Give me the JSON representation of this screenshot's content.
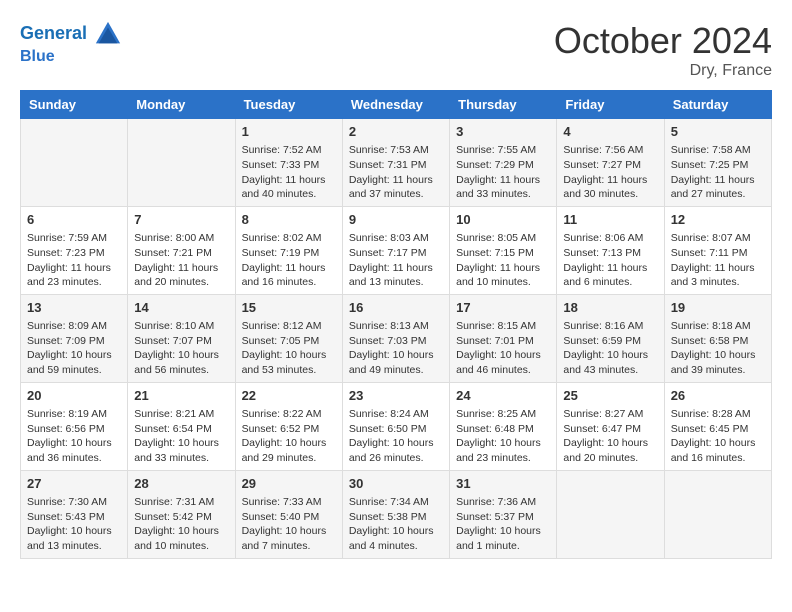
{
  "header": {
    "logo_line1": "General",
    "logo_line2": "Blue",
    "month": "October 2024",
    "location": "Dry, France"
  },
  "weekdays": [
    "Sunday",
    "Monday",
    "Tuesday",
    "Wednesday",
    "Thursday",
    "Friday",
    "Saturday"
  ],
  "weeks": [
    [
      {
        "day": "",
        "content": ""
      },
      {
        "day": "",
        "content": ""
      },
      {
        "day": "1",
        "content": "Sunrise: 7:52 AM\nSunset: 7:33 PM\nDaylight: 11 hours and 40 minutes."
      },
      {
        "day": "2",
        "content": "Sunrise: 7:53 AM\nSunset: 7:31 PM\nDaylight: 11 hours and 37 minutes."
      },
      {
        "day": "3",
        "content": "Sunrise: 7:55 AM\nSunset: 7:29 PM\nDaylight: 11 hours and 33 minutes."
      },
      {
        "day": "4",
        "content": "Sunrise: 7:56 AM\nSunset: 7:27 PM\nDaylight: 11 hours and 30 minutes."
      },
      {
        "day": "5",
        "content": "Sunrise: 7:58 AM\nSunset: 7:25 PM\nDaylight: 11 hours and 27 minutes."
      }
    ],
    [
      {
        "day": "6",
        "content": "Sunrise: 7:59 AM\nSunset: 7:23 PM\nDaylight: 11 hours and 23 minutes."
      },
      {
        "day": "7",
        "content": "Sunrise: 8:00 AM\nSunset: 7:21 PM\nDaylight: 11 hours and 20 minutes."
      },
      {
        "day": "8",
        "content": "Sunrise: 8:02 AM\nSunset: 7:19 PM\nDaylight: 11 hours and 16 minutes."
      },
      {
        "day": "9",
        "content": "Sunrise: 8:03 AM\nSunset: 7:17 PM\nDaylight: 11 hours and 13 minutes."
      },
      {
        "day": "10",
        "content": "Sunrise: 8:05 AM\nSunset: 7:15 PM\nDaylight: 11 hours and 10 minutes."
      },
      {
        "day": "11",
        "content": "Sunrise: 8:06 AM\nSunset: 7:13 PM\nDaylight: 11 hours and 6 minutes."
      },
      {
        "day": "12",
        "content": "Sunrise: 8:07 AM\nSunset: 7:11 PM\nDaylight: 11 hours and 3 minutes."
      }
    ],
    [
      {
        "day": "13",
        "content": "Sunrise: 8:09 AM\nSunset: 7:09 PM\nDaylight: 10 hours and 59 minutes."
      },
      {
        "day": "14",
        "content": "Sunrise: 8:10 AM\nSunset: 7:07 PM\nDaylight: 10 hours and 56 minutes."
      },
      {
        "day": "15",
        "content": "Sunrise: 8:12 AM\nSunset: 7:05 PM\nDaylight: 10 hours and 53 minutes."
      },
      {
        "day": "16",
        "content": "Sunrise: 8:13 AM\nSunset: 7:03 PM\nDaylight: 10 hours and 49 minutes."
      },
      {
        "day": "17",
        "content": "Sunrise: 8:15 AM\nSunset: 7:01 PM\nDaylight: 10 hours and 46 minutes."
      },
      {
        "day": "18",
        "content": "Sunrise: 8:16 AM\nSunset: 6:59 PM\nDaylight: 10 hours and 43 minutes."
      },
      {
        "day": "19",
        "content": "Sunrise: 8:18 AM\nSunset: 6:58 PM\nDaylight: 10 hours and 39 minutes."
      }
    ],
    [
      {
        "day": "20",
        "content": "Sunrise: 8:19 AM\nSunset: 6:56 PM\nDaylight: 10 hours and 36 minutes."
      },
      {
        "day": "21",
        "content": "Sunrise: 8:21 AM\nSunset: 6:54 PM\nDaylight: 10 hours and 33 minutes."
      },
      {
        "day": "22",
        "content": "Sunrise: 8:22 AM\nSunset: 6:52 PM\nDaylight: 10 hours and 29 minutes."
      },
      {
        "day": "23",
        "content": "Sunrise: 8:24 AM\nSunset: 6:50 PM\nDaylight: 10 hours and 26 minutes."
      },
      {
        "day": "24",
        "content": "Sunrise: 8:25 AM\nSunset: 6:48 PM\nDaylight: 10 hours and 23 minutes."
      },
      {
        "day": "25",
        "content": "Sunrise: 8:27 AM\nSunset: 6:47 PM\nDaylight: 10 hours and 20 minutes."
      },
      {
        "day": "26",
        "content": "Sunrise: 8:28 AM\nSunset: 6:45 PM\nDaylight: 10 hours and 16 minutes."
      }
    ],
    [
      {
        "day": "27",
        "content": "Sunrise: 7:30 AM\nSunset: 5:43 PM\nDaylight: 10 hours and 13 minutes."
      },
      {
        "day": "28",
        "content": "Sunrise: 7:31 AM\nSunset: 5:42 PM\nDaylight: 10 hours and 10 minutes."
      },
      {
        "day": "29",
        "content": "Sunrise: 7:33 AM\nSunset: 5:40 PM\nDaylight: 10 hours and 7 minutes."
      },
      {
        "day": "30",
        "content": "Sunrise: 7:34 AM\nSunset: 5:38 PM\nDaylight: 10 hours and 4 minutes."
      },
      {
        "day": "31",
        "content": "Sunrise: 7:36 AM\nSunset: 5:37 PM\nDaylight: 10 hours and 1 minute."
      },
      {
        "day": "",
        "content": ""
      },
      {
        "day": "",
        "content": ""
      }
    ]
  ]
}
